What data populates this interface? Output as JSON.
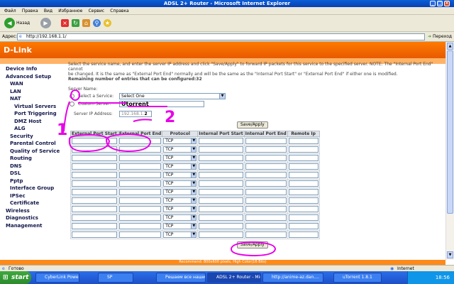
{
  "window": {
    "title": "ADSL 2+ Router - Microsoft Internet Explorer"
  },
  "menu": [
    "Файл",
    "Правка",
    "Вид",
    "Избранное",
    "Сервис",
    "Справка"
  ],
  "toolbar": {
    "back": "Назад"
  },
  "address": {
    "label": "Адрес:",
    "url": "http://192.168.1.1/",
    "go": "Переход"
  },
  "brand": "D-Link",
  "nav": [
    {
      "label": "Device Info",
      "level": 0
    },
    {
      "label": "Advanced Setup",
      "level": 0
    },
    {
      "label": "WAN",
      "level": 1
    },
    {
      "label": "LAN",
      "level": 1
    },
    {
      "label": "NAT",
      "level": 1
    },
    {
      "label": "Virtual Servers",
      "level": 2
    },
    {
      "label": "Port Triggering",
      "level": 2
    },
    {
      "label": "DMZ Host",
      "level": 2
    },
    {
      "label": "ALG",
      "level": 2
    },
    {
      "label": "Security",
      "level": 1
    },
    {
      "label": "Parental Control",
      "level": 1
    },
    {
      "label": "Quality of Service",
      "level": 1
    },
    {
      "label": "Routing",
      "level": 1
    },
    {
      "label": "DNS",
      "level": 1
    },
    {
      "label": "DSL",
      "level": 1
    },
    {
      "label": "Pptp",
      "level": 1
    },
    {
      "label": "Interface Group",
      "level": 1
    },
    {
      "label": "IPSec",
      "level": 1
    },
    {
      "label": "Certificate",
      "level": 1
    },
    {
      "label": "Wireless",
      "level": 0
    },
    {
      "label": "Diagnostics",
      "level": 0
    },
    {
      "label": "Management",
      "level": 0
    }
  ],
  "intro": {
    "line1": "Select the service name, and enter the server IP address and click \"Save/Apply\" to forward IP packets for this service to the specified server. NOTE: The \"Internal Port End\" cannot",
    "line2": "be changed. It is the same as \"External Port End\" normally and will be the same as the \"Internal Port Start\" or \"External Port End\" if either one is modified.",
    "line3": "Remaining number of entries that can be configured:32"
  },
  "form": {
    "server_name_label": "Server Name:",
    "select_service_label": "Select a Service:",
    "select_service_value": "Select One",
    "custom_server_label": "Custom Server:",
    "custom_server_value": "Utorrent",
    "server_ip_label": "Server IP Address:",
    "server_ip_value": "192.168.1.",
    "server_ip_suffix": "2",
    "save_label": "Save/Apply"
  },
  "table": {
    "headers": [
      "External Port Start",
      "External Port End",
      "Protocol",
      "Internal Port Start",
      "Internal Port End",
      "Remote Ip"
    ],
    "protocol_value": "TCP",
    "rows": 12
  },
  "annotations": {
    "one": "1",
    "two": "2"
  },
  "hint": "Recommend: 800x600 pixels, High Color(16 Bits)",
  "status": {
    "left": "Готово",
    "zone": "Internet"
  },
  "taskbar": {
    "start": "start",
    "tasks": [
      "CyberLink PowerDVD",
      "SP",
      "Решаем все наши пр...",
      "ADSL 2+ Router - Mic...",
      "http://anime-az.dan....",
      "uTorrent 1.8.1"
    ],
    "clock": "18:56"
  }
}
